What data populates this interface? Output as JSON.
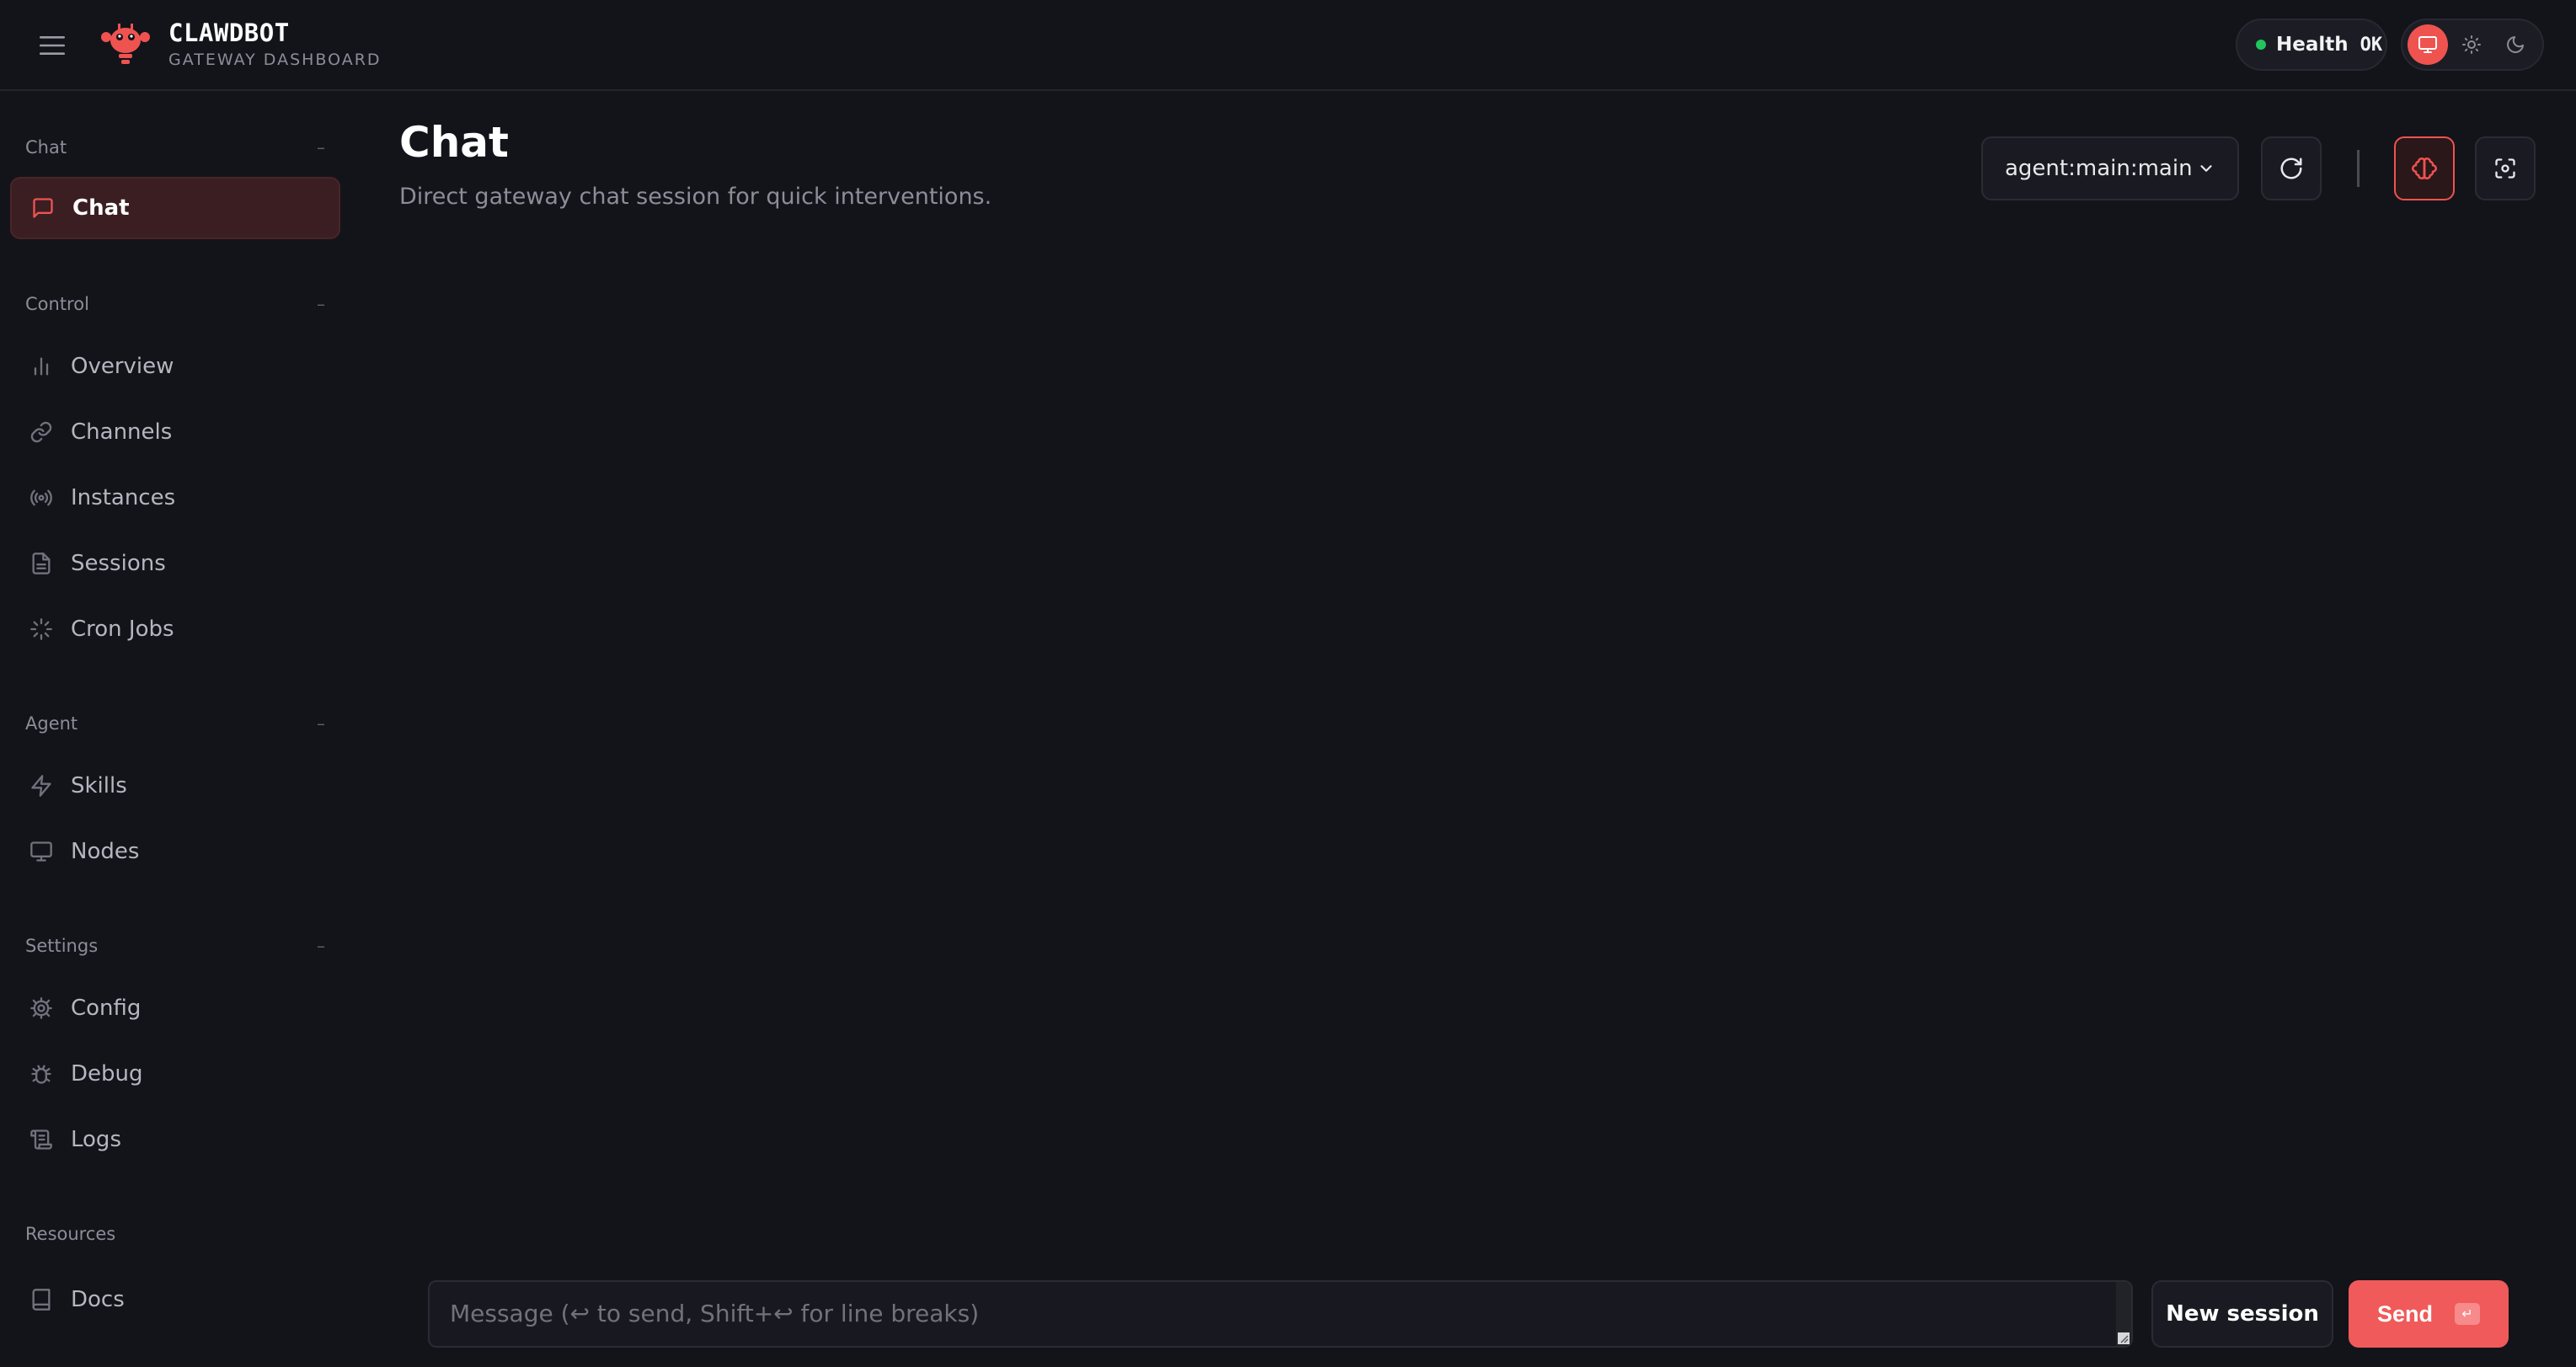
{
  "brand": {
    "title": "CLAWDBOT",
    "subtitle": "GATEWAY DASHBOARD"
  },
  "health": {
    "label": "Health",
    "value": "OK",
    "status_color": "#22c55e"
  },
  "theme": {
    "options": [
      "monitor-icon",
      "sun-icon",
      "moon-icon"
    ],
    "active": "monitor-icon",
    "accent": "#ef5350"
  },
  "sidebar": {
    "sections": [
      {
        "title": "Chat",
        "toggle": "–",
        "items": [
          {
            "label": "Chat",
            "icon": "message-square-icon",
            "active": true
          }
        ]
      },
      {
        "title": "Control",
        "toggle": "–",
        "items": [
          {
            "label": "Overview",
            "icon": "bar-chart-icon"
          },
          {
            "label": "Channels",
            "icon": "link-icon"
          },
          {
            "label": "Instances",
            "icon": "radio-icon"
          },
          {
            "label": "Sessions",
            "icon": "file-text-icon"
          },
          {
            "label": "Cron Jobs",
            "icon": "loader-icon"
          }
        ]
      },
      {
        "title": "Agent",
        "toggle": "–",
        "items": [
          {
            "label": "Skills",
            "icon": "zap-icon"
          },
          {
            "label": "Nodes",
            "icon": "monitor-icon"
          }
        ]
      },
      {
        "title": "Settings",
        "toggle": "–",
        "items": [
          {
            "label": "Config",
            "icon": "gear-icon"
          },
          {
            "label": "Debug",
            "icon": "bug-icon"
          },
          {
            "label": "Logs",
            "icon": "scroll-icon"
          }
        ]
      },
      {
        "title": "Resources",
        "toggle": "",
        "items": [
          {
            "label": "Docs",
            "icon": "book-icon"
          }
        ]
      }
    ]
  },
  "main": {
    "title": "Chat",
    "subtitle": "Direct gateway chat session for quick interventions.",
    "session_select": {
      "value": "agent:main:main"
    },
    "toolbar_icons": [
      "refresh-icon",
      "brain-icon",
      "focus-icon"
    ]
  },
  "composer": {
    "placeholder": "Message (↩ to send, Shift+↩ for line breaks)",
    "value": "",
    "new_session_label": "New session",
    "send_label": "Send",
    "send_kbd": "↵"
  }
}
